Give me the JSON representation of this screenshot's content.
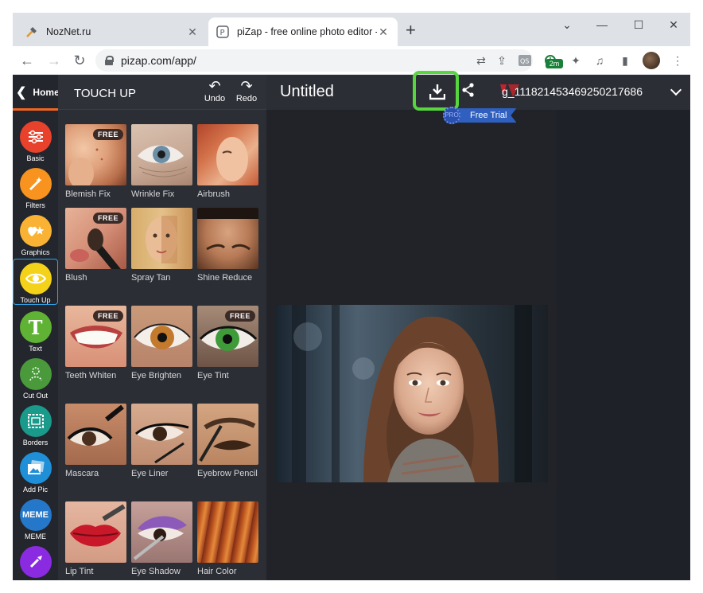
{
  "browser": {
    "tabs": [
      {
        "title": "NozNet.ru",
        "active": false
      },
      {
        "title": "piZap - free online photo editor -",
        "active": true
      }
    ],
    "new_tab_label": "+",
    "url": "pizap.com/app/",
    "extension_badge": "2m"
  },
  "sidebar": {
    "home_label": "Home",
    "tools": [
      {
        "label": "Basic",
        "color": "#e8412c"
      },
      {
        "label": "Filters",
        "color": "#f7931e"
      },
      {
        "label": "Graphics",
        "color": "#f9b233"
      },
      {
        "label": "Touch Up",
        "color": "#f5d21a",
        "active": true
      },
      {
        "label": "Text",
        "color": "#5fb233"
      },
      {
        "label": "Cut Out",
        "color": "#4a9a3c"
      },
      {
        "label": "Borders",
        "color": "#1a9a8a"
      },
      {
        "label": "Add Pic",
        "color": "#1f8fd8"
      },
      {
        "label": "MEME",
        "color": "#2577c9"
      },
      {
        "label": "",
        "color": "#8a2be2"
      }
    ],
    "meme_glyph": "MEME",
    "text_glyph": "T"
  },
  "panel": {
    "title": "TOUCH UP",
    "undo_label": "Undo",
    "redo_label": "Redo",
    "free_badge": "FREE",
    "items": [
      {
        "label": "Blemish Fix",
        "free": true
      },
      {
        "label": "Wrinkle Fix",
        "free": false
      },
      {
        "label": "Airbrush",
        "free": false
      },
      {
        "label": "Blush",
        "free": true
      },
      {
        "label": "Spray Tan",
        "free": false
      },
      {
        "label": "Shine Reduce",
        "free": false
      },
      {
        "label": "Teeth Whiten",
        "free": true
      },
      {
        "label": "Eye Brighten",
        "free": false
      },
      {
        "label": "Eye Tint",
        "free": true
      },
      {
        "label": "Mascara",
        "free": false
      },
      {
        "label": "Eye Liner",
        "free": false
      },
      {
        "label": "Eyebrow Pencil",
        "free": false
      },
      {
        "label": "Lip Tint",
        "free": false
      },
      {
        "label": "Eye Shadow",
        "free": false
      },
      {
        "label": "Hair Color",
        "free": false
      }
    ]
  },
  "editor": {
    "document_title": "Untitled",
    "free_trial_label": "Free Trial",
    "pro_label": "PRO",
    "user_id": "g_111821453469250217686",
    "highlight_color": "#57d63d"
  }
}
